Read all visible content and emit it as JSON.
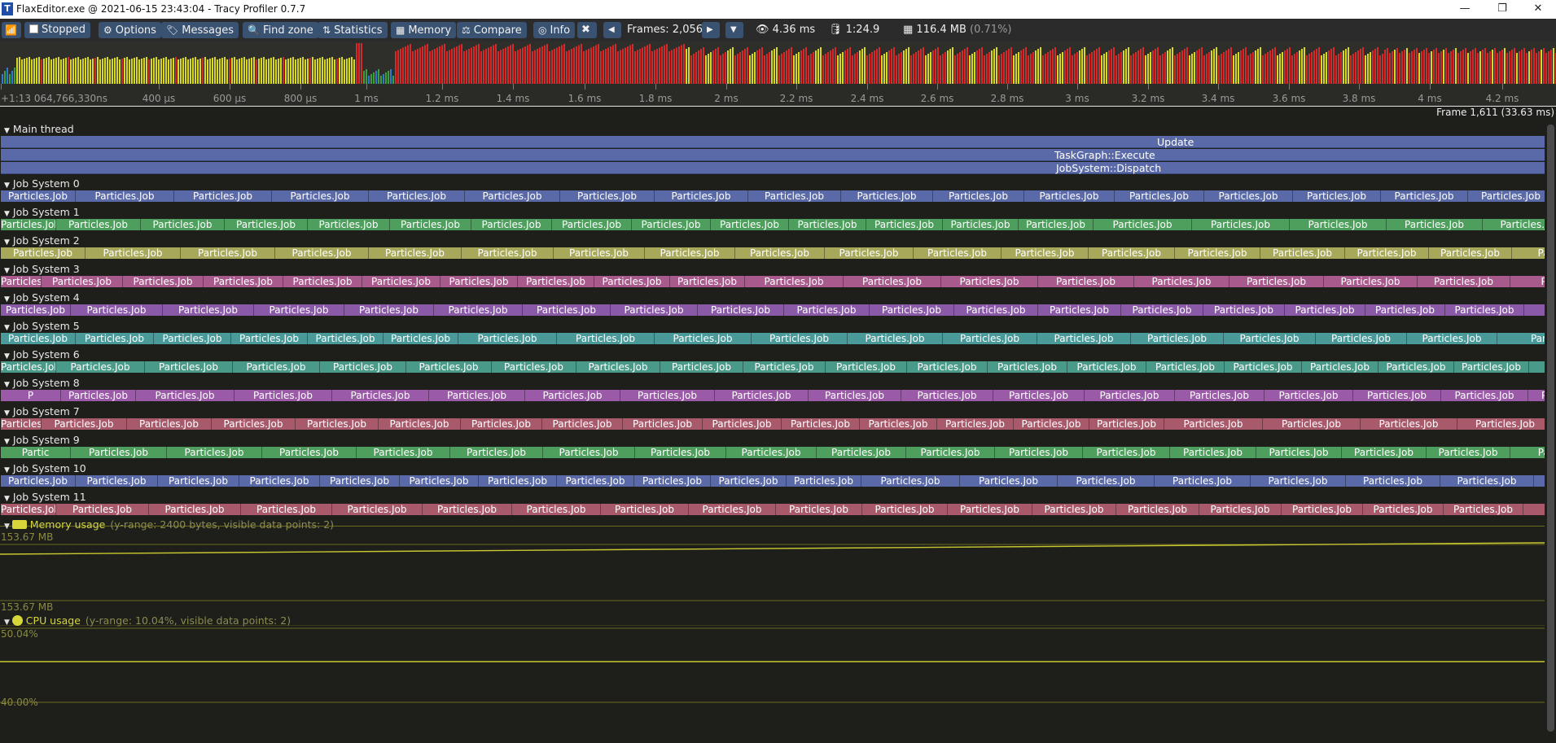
{
  "window": {
    "title": "FlaxEditor.exe @ 2021-06-15 23:43:04 - Tracy Profiler 0.7.7",
    "minimize": "—",
    "restore": "❐",
    "close": "✕"
  },
  "toolbar": {
    "stopped_label": "Stopped",
    "options_label": "Options",
    "messages_label": "Messages",
    "findzone_label": "Find zone",
    "statistics_label": "Statistics",
    "memory_label": "Memory",
    "compare_label": "Compare",
    "info_label": "Info",
    "frames_label": "Frames: 2,056",
    "view_time": "4.36 ms",
    "db_time": "1:24.9",
    "memory_value": "116.4 MB",
    "memory_pct": "(0.71%)"
  },
  "framebar": {
    "colors": {
      "red": "#d22b2b",
      "yellow": "#d8d820",
      "green": "#3ca03c",
      "blue": "#2c7ad2"
    }
  },
  "ruler": {
    "ticks": [
      "+1:13 064,766,330ns",
      "400 µs",
      "600 µs",
      "800 µs",
      "1 ms",
      "1.2 ms",
      "1.4 ms",
      "1.6 ms",
      "1.8 ms",
      "2 ms",
      "2.2 ms",
      "2.4 ms",
      "2.6 ms",
      "2.8 ms",
      "3 ms",
      "3.2 ms",
      "3.4 ms",
      "3.6 ms",
      "3.8 ms",
      "4 ms",
      "4.2 ms"
    ],
    "frame_label": "Frame 1,611 (33.63 ms)"
  },
  "main_thread": {
    "name": "Main thread",
    "zones": [
      "Update",
      "TaskGraph::Execute",
      "JobSystem::Dispatch"
    ]
  },
  "job_label": "Particles.Job",
  "job_systems": [
    {
      "name": "Job System 0",
      "color": "#5a6aa8",
      "first": "Particles.Job",
      "last": "Particles.Job"
    },
    {
      "name": "Job System 1",
      "color": "#4e9e5e",
      "first": "Particles.Job",
      "last": "Particles.Job"
    },
    {
      "name": "Job System 2",
      "color": "#a8a85a",
      "first": "Particles.Job",
      "last": "Particl"
    },
    {
      "name": "Job System 3",
      "color": "#a85a8c",
      "first": "Particles.Job",
      "last": "Particl"
    },
    {
      "name": "Job System 4",
      "color": "#8a5aa8",
      "first": "Particles.Job",
      "last": "Par"
    },
    {
      "name": "Job System 5",
      "color": "#4a9a9a",
      "first": "Particles.Job",
      "last": "Parti"
    },
    {
      "name": "Job System 6",
      "color": "#4a9a8a",
      "first": "Particles.Job",
      "last": "Particles.Job"
    },
    {
      "name": "Job System 8",
      "color": "#9a5aa8",
      "first": "P",
      "last": "Particles.Job"
    },
    {
      "name": "Job System 7",
      "color": "#a85a6a",
      "first": "Particles.Job",
      "last": "Particles.Job"
    },
    {
      "name": "Job System 9",
      "color": "#4e9e5e",
      "first": "Partic",
      "last": "Partic"
    },
    {
      "name": "Job System 10",
      "color": "#5a6aa8",
      "first": "Particles.Job",
      "last": "Particles.Job"
    },
    {
      "name": "Job System 11",
      "color": "#a85a6a",
      "first": "Particles.Job",
      "last": "Particle"
    }
  ],
  "memory_plot": {
    "title": "Memory usage",
    "subtitle": "(y-range: 2400 bytes, visible data points: 2)",
    "top_label": "153.67 MB",
    "bottom_label": "153.67 MB"
  },
  "cpu_plot": {
    "title": "CPU usage",
    "subtitle": "(y-range: 10.04%, visible data points: 2)",
    "top_label": "50.04%",
    "bottom_label": "40.00%"
  }
}
